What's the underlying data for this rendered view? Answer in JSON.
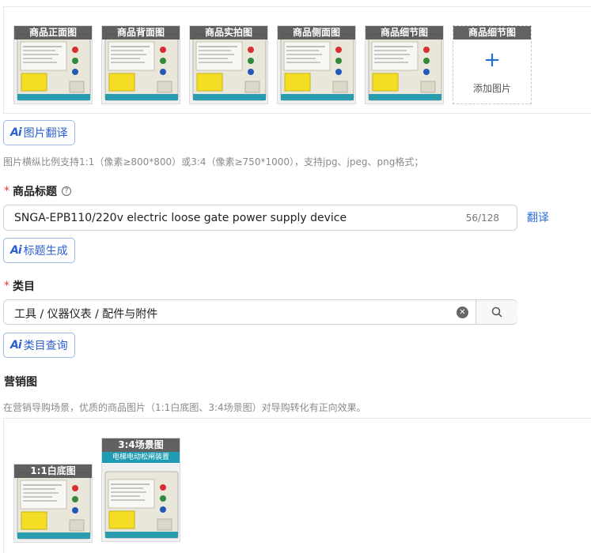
{
  "product_images": {
    "tiles": [
      {
        "caption": "商品正面图"
      },
      {
        "caption": "商品背面图"
      },
      {
        "caption": "商品实拍图"
      },
      {
        "caption": "商品侧面图"
      },
      {
        "caption": "商品细节图"
      }
    ],
    "add_tile": {
      "caption": "商品细节图",
      "label": "添加图片"
    },
    "ai_button": "图片翻译",
    "hint": "图片横纵比例支持1:1（像素≥800*800）或3:4（像素≥750*1000），支持jpg、jpeg、png格式；"
  },
  "title_field": {
    "required_mark": "*",
    "label": "商品标题",
    "help_icon": "question-circle-icon",
    "value": "SNGA-EPB110/220v electric loose gate power supply device",
    "count": "56/128",
    "translate_link": "翻译",
    "ai_button": "标题生成"
  },
  "category_field": {
    "required_mark": "*",
    "label": "类目",
    "value": "工具 / 仪器仪表 / 配件与附件",
    "ai_button": "类目查询"
  },
  "marketing": {
    "label": "营销图",
    "hint": "在营销导购场景，优质的商品图片（1:1白底图、3:4场景图）对导购转化有正向效果。",
    "tiles": [
      {
        "caption": "1:1白底图"
      },
      {
        "caption": "3:4场景图",
        "banner_text": "电梯电动松闸装置"
      }
    ]
  },
  "ai_mark": "Ai",
  "colors": {
    "accent": "#2b6fd6",
    "required": "#e23b2e",
    "device_body": "#e9e6da",
    "label_yellow": "#f4dd24"
  }
}
